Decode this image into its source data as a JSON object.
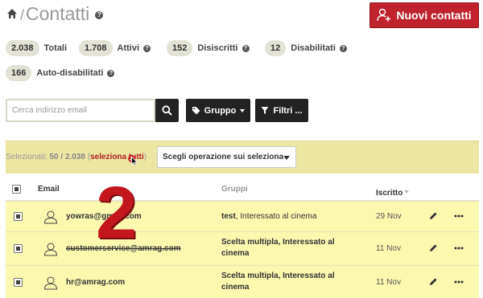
{
  "header": {
    "home_icon": "home-icon",
    "separator": "/",
    "title": "Contatti",
    "new_button_label": "Nuovi contatti",
    "new_button_icon": "add-user-icon",
    "accent": "#c0232c"
  },
  "stats": [
    {
      "value": "2.038",
      "label": "Totali",
      "help": false
    },
    {
      "value": "1.708",
      "label": "Attivi",
      "help": true
    },
    {
      "value": "152",
      "label": "Disiscritti",
      "help": true
    },
    {
      "value": "12",
      "label": "Disabilitati",
      "help": true
    },
    {
      "value": "166",
      "label": "Auto-disabilitati",
      "help": true
    }
  ],
  "filters": {
    "search_placeholder": "Cerca indirizzo email",
    "group_label": "Gruppo",
    "filter_label": "Filtri ..."
  },
  "selection": {
    "prefix": "Selezionati: ",
    "count": "50 / 2.038",
    "open_paren": " (",
    "select_all_label": "seleziona tutti",
    "close_paren": ")",
    "operation_select": "Scegli operazione sui seleziona"
  },
  "table": {
    "headers": {
      "email": "Email",
      "groups": "Gruppi",
      "subscribed": "Iscritto"
    },
    "rows": [
      {
        "email": "yowras@gmail.com",
        "groups_bold": "test",
        "groups_rest": ", Interessato al cinema",
        "date": "29 Nov",
        "struck": false
      },
      {
        "email": "customerservice@amrag.com",
        "groups_bold": "Scelta multipla",
        "groups_rest": ", Interessato al cinema",
        "date": "11 Nov",
        "struck": true
      },
      {
        "email": "hr@amrag.com",
        "groups_bold": "Scelta multipla",
        "groups_rest": ", Interessato al cinema",
        "date": "11 Nov",
        "struck": false
      }
    ]
  },
  "overlay": {
    "step_number": "2",
    "color": "#c3161d"
  }
}
